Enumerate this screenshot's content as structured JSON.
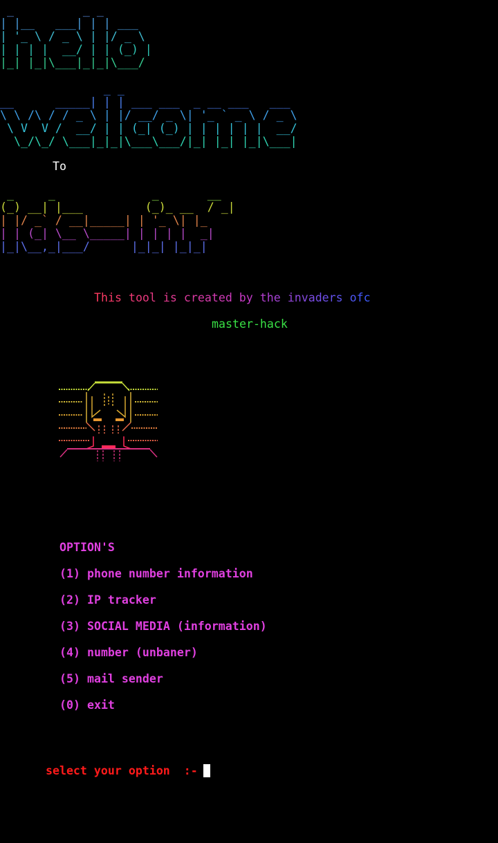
{
  "banner_hello": [
    " _          _ _",
    "| |__   ___| | | ___",
    "| '_ \\ / _ \\ | |/ _ \\",
    "| | | |  __/ | | (_) |",
    "|_| |_|\\___|_|_|\\___/"
  ],
  "banner_welcome": [
    "               _ _",
    "__      _____| | | ___ ___  _ __ ___   ___",
    "\\ \\ /\\ / / _ \\ | |/ __/ _ \\| '_ ` _ \\ / _ \\",
    " \\ V  V /  __/ | | (_| (_) | | | | | |  __/",
    "  \\_/\\_/ \\___|_|_|\\___\\___/|_| |_| |_|\\___|"
  ],
  "banner_to": "To",
  "banner_tool": [
    " _     _              _       __",
    "(_) __| |___         (_)_ __  / _|",
    "| |/ _` / __|_____| | '_ \\| |_",
    "| | (_| \\__ \\_____| | | | |  _|",
    "|_|\\__,_|___/      |_|_| |_|_|"
  ],
  "credit_line": "This tool is created by the invaders ofc",
  "author": "master-hack",
  "menu": {
    "heading": "OPTION'S",
    "options": [
      "(1) phone number information",
      "(2) IP tracker",
      "(3) SOCIAL MEDIA (information)",
      "(4) number (unbaner)",
      "(5) mail sender",
      "(0) exit"
    ]
  },
  "prompt": "select your option  :-",
  "colors": {
    "background": "#000000",
    "hello": [
      "#5b8ee6",
      "#4a9fe0",
      "#3fbad0",
      "#2fc6b5",
      "#36cc90"
    ],
    "welcome": [
      "#3f7cf0",
      "#4a7ff0",
      "#3f9fe8",
      "#35c0d6",
      "#2fd2b0"
    ],
    "tool": [
      "#8fe04a",
      "#c9d83a",
      "#e0834a",
      "#b64ac8",
      "#5b6ee8"
    ],
    "credit_start": "#ff3a5c",
    "credit_end": "#3a5cff",
    "author": "#39e045",
    "menu": "#e040e0",
    "prompt": "#ff1a1a",
    "skull": [
      "#c8e03a",
      "#d8c038",
      "#e89830",
      "#e86848",
      "#ff2a5a",
      "#d83080"
    ],
    "cursor": "#ffffff"
  },
  "icons": [
    "skull-icon",
    "terminal-cursor"
  ]
}
